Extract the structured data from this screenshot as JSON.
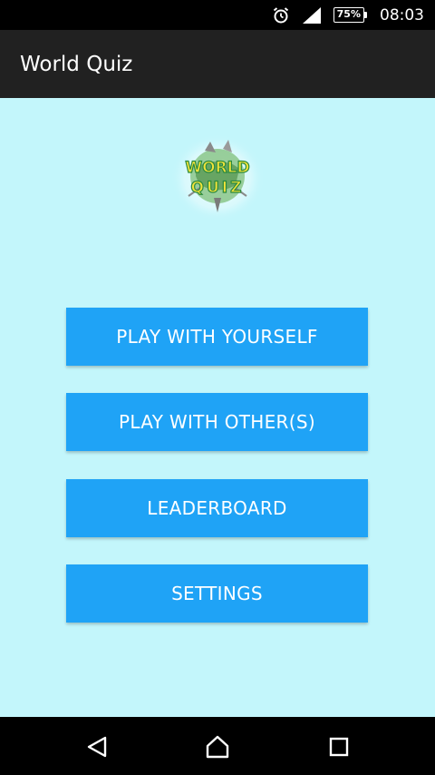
{
  "status_bar": {
    "time": "08:03",
    "battery": "75%",
    "icons": [
      "alarm-icon",
      "signal-icon",
      "battery-icon"
    ]
  },
  "app_bar": {
    "title": "World Quiz"
  },
  "logo": {
    "text_line1": "WORLD",
    "text_line2": "QUIZ"
  },
  "menu": {
    "play_yourself": "PLAY WITH YOURSELF",
    "play_others": "PLAY WITH OTHER(S)",
    "leaderboard": "LEADERBOARD",
    "settings": "SETTINGS"
  },
  "nav_bar": {
    "icons": [
      "back-icon",
      "home-icon",
      "recents-icon"
    ]
  },
  "colors": {
    "background": "#c3f6fb",
    "app_bar": "#212121",
    "button": "#1fa3f6",
    "logo_text": "#f2e23a",
    "logo_outline": "#2b8a3e"
  }
}
